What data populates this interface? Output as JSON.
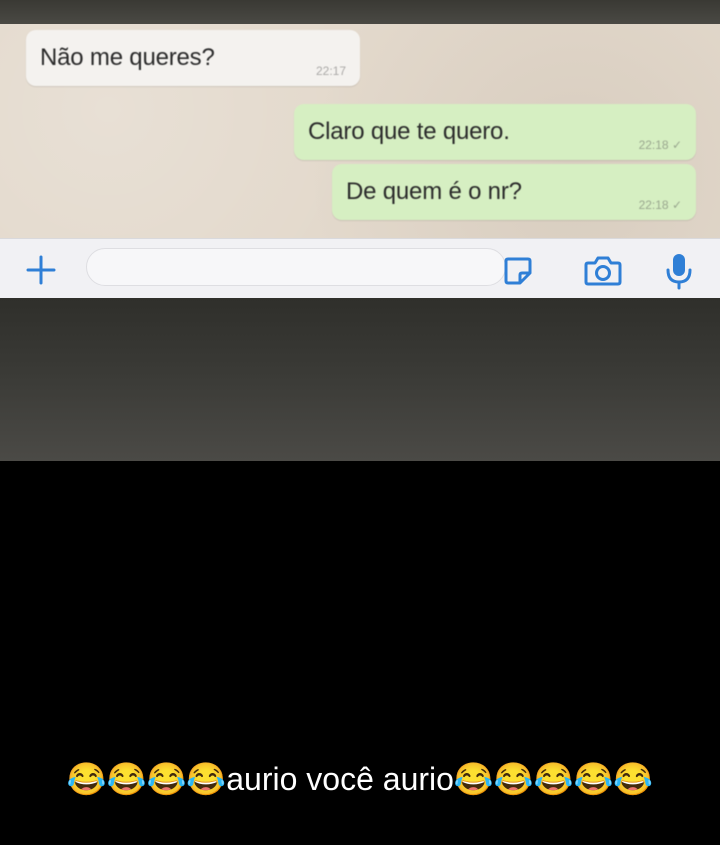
{
  "chat": {
    "messages": [
      {
        "text": "Não me queres?",
        "time": "22:17",
        "direction": "incoming"
      },
      {
        "text": "Claro que te quero.",
        "time": "22:18 ✓",
        "direction": "outgoing"
      },
      {
        "text": "De quem é o nr?",
        "time": "22:18 ✓",
        "direction": "outgoing"
      }
    ]
  },
  "input_bar": {
    "icons": [
      "plus-icon",
      "sticker-icon",
      "camera-icon",
      "microphone-icon"
    ],
    "accent_color": "#2f7fd6"
  },
  "colors": {
    "incoming_bubble": "#f4f2ef",
    "outgoing_bubble": "#d6efc2",
    "chat_background": "#e3d9cc",
    "page_background": "#000000"
  },
  "caption": {
    "text": "😂😂😂😂aurio você aurio😂😂😂😂😂"
  }
}
